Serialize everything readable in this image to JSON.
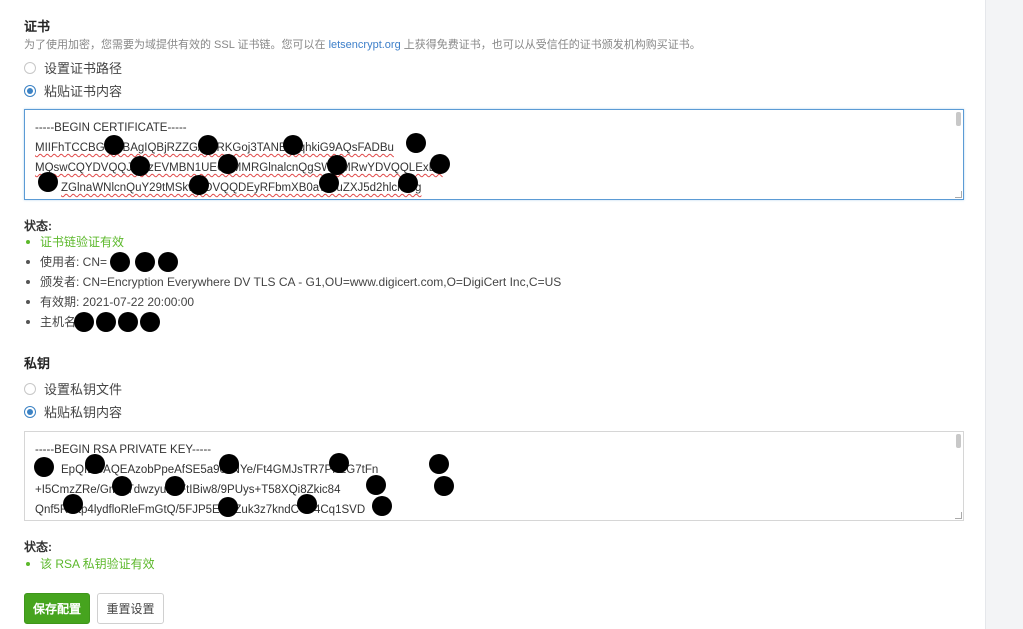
{
  "certificate": {
    "title": "证书",
    "description_before": "为了使用加密，您需要为域提供有效的 SSL 证书链。您可以在 ",
    "description_link": "letsencrypt.org",
    "description_after": " 上获得免费证书，也可以从受信任的证书颁发机构购买证书。",
    "radio_path_label": "设置证书路径",
    "radio_paste_label": "粘贴证书内容",
    "selected": "paste",
    "content_lines": [
      "-----BEGIN CERTIFICATE-----",
      "MIIFhTCCBGuwIBAgIQBjRZZG/wTRKGoj3TANBgkqhkiG9AQsFADBu",
      "MQswCQYDVQQJVUzEVMBN1UEChMMRGlnalcnQgSW5jMRwYDVQQLExB3",
      "ZGlnaWNlcnQuY29tMSkwYDVQQDEyRFbmXB0aW9uZXJ5d2hlcmUg"
    ],
    "status_label": "状态:",
    "status_items": [
      {
        "text": "证书链验证有效",
        "ok": true
      },
      {
        "text": "使用者: CN=",
        "ok": false
      },
      {
        "text": "颁发者: CN=Encryption Everywhere DV TLS CA - G1,OU=www.digicert.com,O=DigiCert Inc,C=US",
        "ok": false
      },
      {
        "text": "有效期: 2021-07-22 20:00:00",
        "ok": false
      },
      {
        "text": "主机名",
        "ok": false
      }
    ]
  },
  "private_key": {
    "title": "私钥",
    "radio_file_label": "设置私钥文件",
    "radio_paste_label": "粘贴私钥内容",
    "selected": "paste",
    "content_lines": [
      "-----BEGIN RSA PRIVATE KEY-----",
      "EpQIBCAQEAzobPpeAfSE5a90zNYe/Ft4GMJsTR7PP2G7tFn",
      "+I5CmzZRe/GmNTdwzyurQFtIBiw8/9PUys+T58XQi8Zkic84",
      "Qnf5Rt5tp4lydfloRleFmGtQ/5FJP5ETPZuk3z7kndC+C4Cq1SVD"
    ],
    "status_label": "状态:",
    "status_items": [
      {
        "text": "该 RSA 私钥验证有效",
        "ok": true
      }
    ]
  },
  "buttons": {
    "save_label": "保存配置",
    "reset_label": "重置设置"
  },
  "colors": {
    "accent": "#3b82c4",
    "success": "#5cb82b",
    "primary_button": "#46a41e",
    "link": "#3d7fc9"
  }
}
